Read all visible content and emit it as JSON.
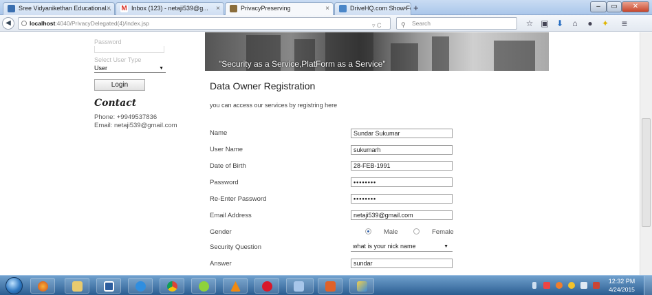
{
  "browser": {
    "tabs": [
      {
        "label": "Sree Vidyanikethan Educational...",
        "favicon_color": "#3a6fb0"
      },
      {
        "label": "Inbox (123) - netaji539@g...",
        "favicon_color": "#d93025"
      },
      {
        "label": "PrivacyPreserving",
        "favicon_color": "#8a6d3b"
      },
      {
        "label": "DriveHQ.com Show Folder ...",
        "favicon_color": "#4a86c8"
      }
    ],
    "new_tab_symbol": "+",
    "close_symbol": "×",
    "address_host": "localhost",
    "address_rest": ":4040/PrivacyDelegated(4)/index.jsp",
    "search_placeholder": "Search"
  },
  "sidebar": {
    "password_label": "Password",
    "user_type_label": "Select User Type",
    "user_type_value": "User",
    "login_label": "Login",
    "contact_title": "Contact",
    "phone": "Phone: +9949537836",
    "email": "Email: netaji539@gmail.com"
  },
  "banner": {
    "caption": "\"Security as a Service,PlatForm as a Service\""
  },
  "form": {
    "title": "Data Owner Registration",
    "intro": "you can access our services by registring here",
    "name_label": "Name",
    "name_value": "Sundar Sukumar",
    "username_label": "User Name",
    "username_value": "sukumarh",
    "dob_label": "Date of Birth",
    "dob_value": "28-FEB-1991",
    "password_label": "Password",
    "password_value": "••••••••",
    "reenter_label": "Re-Enter Password",
    "reenter_value": "••••••••",
    "email_label": "Email Address",
    "email_value": "netaji539@gmail.com",
    "gender_label": "Gender",
    "gender_options": [
      "Male",
      "Female"
    ],
    "gender_selected": "Male",
    "security_label": "Security Question",
    "security_value": "what is your nick name",
    "answer_label": "Answer",
    "answer_value": "sundar"
  },
  "taskbar": {
    "clock_time": "12:32 PM",
    "clock_date": "4/24/2015"
  }
}
